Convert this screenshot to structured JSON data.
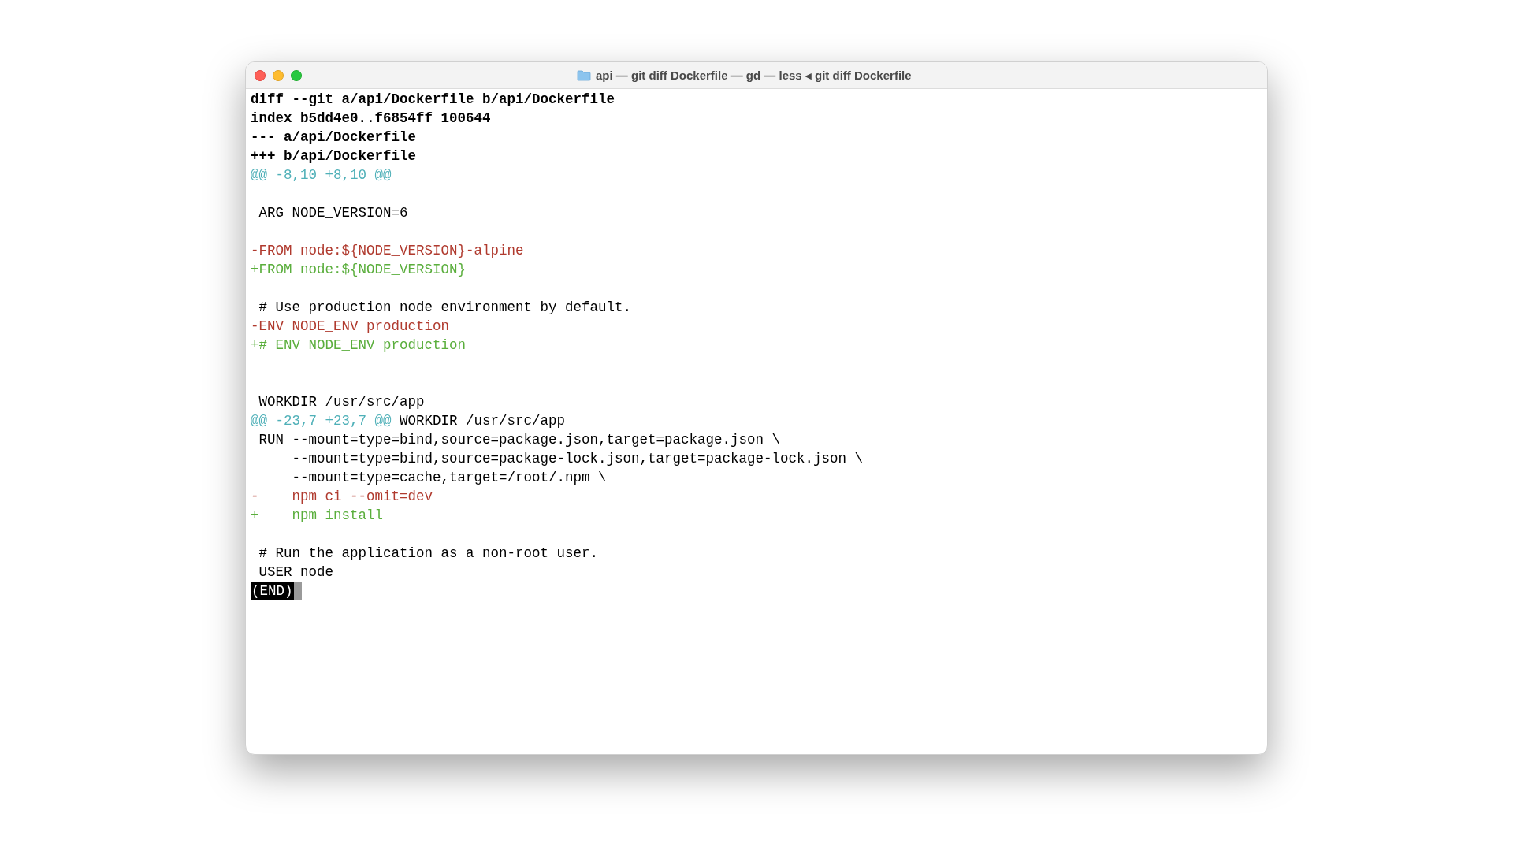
{
  "window": {
    "title": "api — git diff Dockerfile — gd — less ◂ git diff Dockerfile"
  },
  "lines": [
    {
      "kind": "header",
      "text": "diff --git a/api/Dockerfile b/api/Dockerfile"
    },
    {
      "kind": "header",
      "text": "index b5dd4e0..f6854ff 100644"
    },
    {
      "kind": "header",
      "text": "--- a/api/Dockerfile"
    },
    {
      "kind": "header",
      "text": "+++ b/api/Dockerfile"
    },
    {
      "kind": "hunk",
      "text": "@@ -8,10 +8,10 @@"
    },
    {
      "kind": "blank"
    },
    {
      "kind": "context",
      "text": " ARG NODE_VERSION=6"
    },
    {
      "kind": "blank"
    },
    {
      "kind": "deleted",
      "text": "-FROM node:${NODE_VERSION}-alpine"
    },
    {
      "kind": "added",
      "text": "+FROM node:${NODE_VERSION}"
    },
    {
      "kind": "blank"
    },
    {
      "kind": "context",
      "text": " # Use production node environment by default."
    },
    {
      "kind": "deleted",
      "text": "-ENV NODE_ENV production"
    },
    {
      "kind": "added",
      "text": "+# ENV NODE_ENV production"
    },
    {
      "kind": "blank"
    },
    {
      "kind": "blank"
    },
    {
      "kind": "context",
      "text": " WORKDIR /usr/src/app"
    },
    {
      "kind": "hunk",
      "text": "@@ -23,7 +23,7 @@",
      "context": " WORKDIR /usr/src/app"
    },
    {
      "kind": "context",
      "text": " RUN --mount=type=bind,source=package.json,target=package.json \\"
    },
    {
      "kind": "context",
      "text": "     --mount=type=bind,source=package-lock.json,target=package-lock.json \\"
    },
    {
      "kind": "context",
      "text": "     --mount=type=cache,target=/root/.npm \\"
    },
    {
      "kind": "deleted",
      "text": "-    npm ci --omit=dev"
    },
    {
      "kind": "added",
      "text": "+    npm install"
    },
    {
      "kind": "blank"
    },
    {
      "kind": "context",
      "text": " # Run the application as a non-root user."
    },
    {
      "kind": "context",
      "text": " USER node"
    }
  ],
  "pager": {
    "end_marker": "(END)"
  }
}
